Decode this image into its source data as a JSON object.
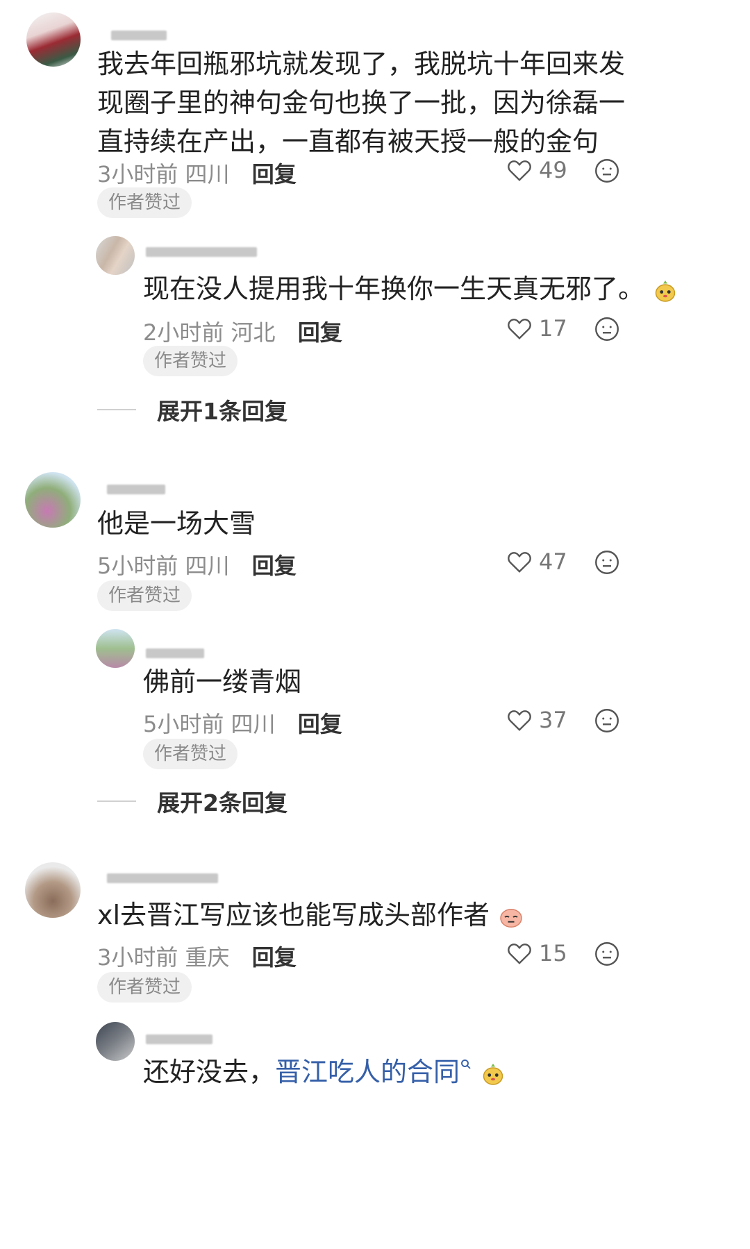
{
  "comments": [
    {
      "text": "我去年回瓶邪坑就发现了，我脱坑十年回来发现圈子里的神句金句也换了一批，因为徐磊一直持续在产出，一直都有被天授一般的金句",
      "time": "3小时前",
      "location": "四川",
      "reply_label": "回复",
      "likes": "49",
      "badge": "作者赞过"
    },
    {
      "text": "现在没人提用我十年换你一生天真无邪了。",
      "time": "2小时前",
      "location": "河北",
      "reply_label": "回复",
      "likes": "17",
      "badge": "作者赞过"
    },
    {
      "text": "他是一场大雪",
      "time": "5小时前",
      "location": "四川",
      "reply_label": "回复",
      "likes": "47",
      "badge": "作者赞过"
    },
    {
      "text": "佛前一缕青烟",
      "time": "5小时前",
      "location": "四川",
      "reply_label": "回复",
      "likes": "37",
      "badge": "作者赞过"
    },
    {
      "text": "xl去晋江写应该也能写成头部作者",
      "time": "3小时前",
      "location": "重庆",
      "reply_label": "回复",
      "likes": "15",
      "badge": "作者赞过"
    },
    {
      "text_before": "还好没去，",
      "link_text": "晋江吃人的合同"
    }
  ],
  "expand": [
    {
      "label": "展开1条回复"
    },
    {
      "label": "展开2条回复"
    }
  ],
  "icons": {
    "like": "heart-outline-icon",
    "more": "meh-face-icon",
    "emoji": "sticker-emoji-icon"
  },
  "colors": {
    "link": "#355fa8",
    "meta": "#8c8c8c",
    "badge_bg": "#f0f0f0"
  }
}
